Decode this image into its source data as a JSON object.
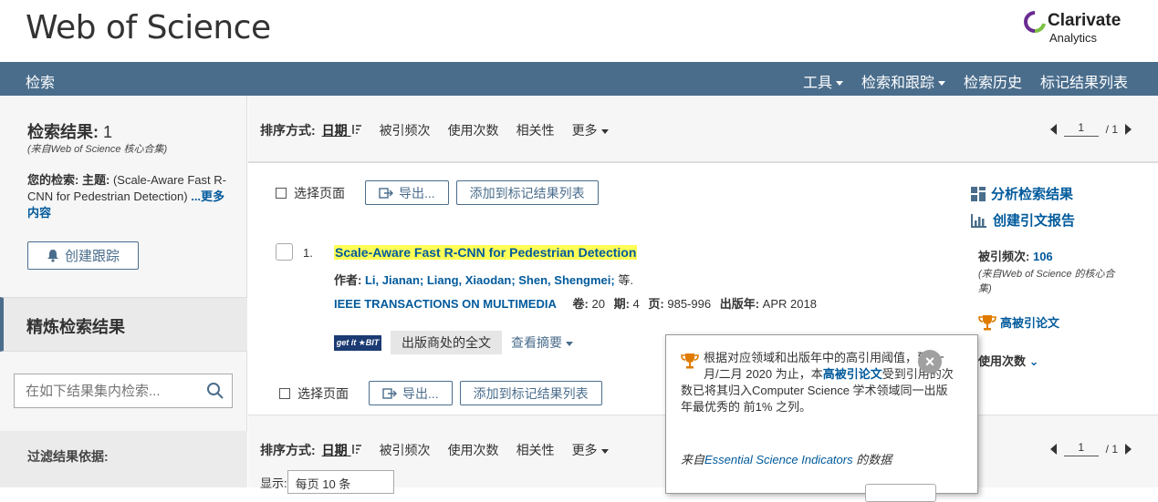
{
  "header": {
    "brand": "Web of Science",
    "vendor_name": "Clarivate",
    "vendor_sub": "Analytics"
  },
  "nav": {
    "search": "检索",
    "items": [
      {
        "label": "工具",
        "dropdown": true
      },
      {
        "label": "检索和跟踪",
        "dropdown": true
      },
      {
        "label": "检索历史",
        "dropdown": false
      },
      {
        "label": "标记结果列表",
        "dropdown": false
      }
    ]
  },
  "sidebar": {
    "results_label": "检索结果:",
    "results_count": "1",
    "from_core": "(来自Web of Science 核心合集)",
    "your_search_label": "您的检索:",
    "topic_label": "主题:",
    "query": "(Scale-Aware Fast R-CNN for Pedestrian Detection)",
    "more": "...更多内容",
    "create_alert": "创建跟踪",
    "refine_title": "精炼检索结果",
    "refine_placeholder": "在如下结果集内检索...",
    "filter_by": "过滤结果依据:"
  },
  "sort": {
    "label": "排序方式:",
    "date": "日期",
    "options": [
      "被引频次",
      "使用次数",
      "相关性"
    ],
    "more": "更多"
  },
  "pager": {
    "current": "1",
    "total": "/ 1"
  },
  "actions": {
    "select_page": "选择页面",
    "export": "导出...",
    "add_marked": "添加到标记结果列表"
  },
  "record": {
    "number": "1.",
    "title": "Scale-Aware Fast R-CNN for Pedestrian Detection",
    "authors_label": "作者:",
    "authors": "Li, Jianan; Liang, Xiaodan; Shen, Shengmei;",
    "et_al": "等.",
    "journal": "IEEE TRANSACTIONS ON MULTIMEDIA",
    "volume_label": "卷:",
    "volume": "20",
    "issue_label": "期:",
    "issue": "4",
    "pages_label": "页:",
    "pages": "985-996",
    "year_label": "出版年:",
    "year": "APR 2018",
    "getit": "get it ★BIT",
    "fulltext": "出版商处的全文",
    "abstract": "查看摘要"
  },
  "side": {
    "analyze": "分析检索结果",
    "citation_report": "创建引文报告",
    "times_cited_label": "被引频次:",
    "times_cited": "106",
    "cited_from": "(来自Web of Science 的核心合集)",
    "hot_paper": "高被引论文",
    "usage": "使用次数"
  },
  "popup": {
    "text1": "根据对应领域和出版年中的高引用阈值，到 一月/二月 2020 为止，本",
    "highlight": "高被引论文",
    "text2": "受到引用的次数已将其归入Computer Science 学术领域同一出版年最优秀的 前1% 之列。",
    "source_prefix": "来自",
    "source_name": "Essential Science Indicators",
    "source_suffix": " 的数据"
  },
  "show": {
    "label": "显示:",
    "value": "每页 10 条"
  },
  "colors": {
    "nav": "#4a6d8c",
    "link": "#005a9c",
    "highlight": "#ffff55",
    "trophy": "#e07b00"
  }
}
